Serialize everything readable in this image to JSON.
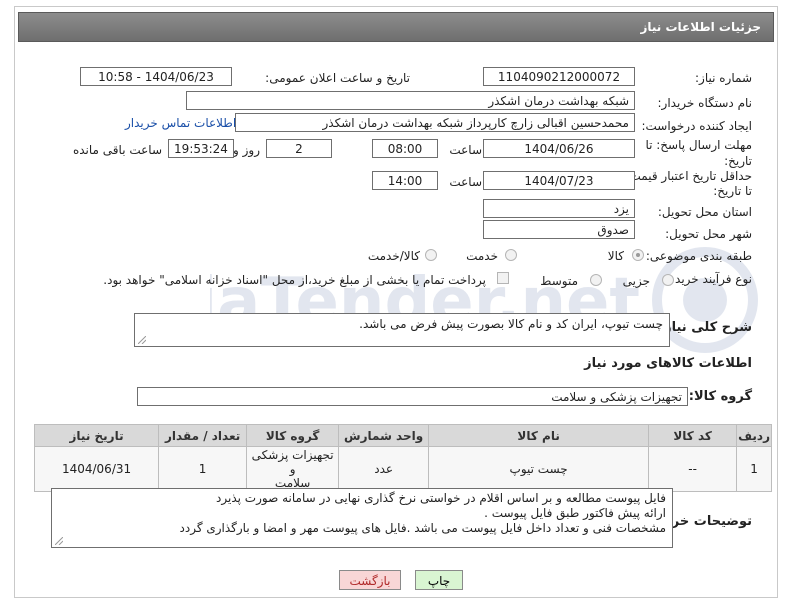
{
  "header": {
    "title": "جزئیات اطلاعات نیاز"
  },
  "form": {
    "need_number": {
      "label": "شماره نیاز:",
      "value": "1104090212000072"
    },
    "announce": {
      "label": "تاریخ و ساعت اعلان عمومی:",
      "value": "1404/06/23 - 10:58"
    },
    "buyer_org": {
      "label": "نام دستگاه خریدار:",
      "value": "شبکه بهداشت درمان اشکذر"
    },
    "creator": {
      "label": "ایجاد کننده درخواست:",
      "value": "محمدحسین اقبالی زارچ کارپرداز شبکه بهداشت درمان اشکذر",
      "contact_link": "اطلاعات تماس خریدار"
    },
    "reply_deadline": {
      "label_line1": "مهلت ارسال پاسخ: تا",
      "label_line2": "تاریخ:",
      "date": "1404/06/26",
      "time_label": "ساعت",
      "time": "08:00",
      "days": "2",
      "days_label": "روز و",
      "remaining": "19:53:24",
      "remaining_label": "ساعت باقی مانده"
    },
    "price_validity": {
      "label_line1": "حداقل تاریخ اعتبار قیمت:",
      "label_line2": "تا تاریخ:",
      "date": "1404/07/23",
      "time_label": "ساعت",
      "time": "14:00"
    },
    "province": {
      "label": "استان محل تحویل:",
      "value": "یزد"
    },
    "city": {
      "label": "شهر محل تحویل:",
      "value": "صدوق"
    },
    "category": {
      "label": "طبقه بندی موضوعی:",
      "options": [
        "کالا",
        "خدمت",
        "کالا/خدمت"
      ],
      "selected": "کالا"
    },
    "purchase_type": {
      "label": "نوع فرآیند خرید :",
      "options": [
        "جزیی",
        "متوسط"
      ],
      "payment_note": "پرداخت تمام یا بخشی از مبلغ خرید،از محل \"اسناد خزانه اسلامی\" خواهد بود."
    },
    "general_description": {
      "label": "شرح کلی نیاز:",
      "value": "چست تیوپ، ایران کد و نام کالا بصورت پیش فرض می باشد."
    }
  },
  "goods_section": {
    "title": "اطلاعات کالاهای مورد نیاز",
    "group_label": "گروه کالا:",
    "group_value": "تجهیزات پزشکی و سلامت",
    "columns": [
      "ردیف",
      "کد کالا",
      "نام کالا",
      "واحد شمارش",
      "گروه کالا",
      "تعداد / مقدار",
      "تاریخ نیاز"
    ],
    "rows": [
      {
        "row": "1",
        "code": "--",
        "name": "چست تیوپ",
        "unit": "عدد",
        "group_l1": "تجهیزات پزشکی و",
        "group_l2": "سلامت",
        "qty": "1",
        "date": "1404/06/31"
      }
    ]
  },
  "buyer_notes": {
    "label": "توضیحات خریدار:",
    "lines": [
      "فایل پیوست مطالعه و بر اساس اقلام در خواستی نرخ گذاری نهایی در سامانه صورت پذیرد",
      "ارائه پیش فاکتور طبق فایل پیوست .",
      "مشخصات فنی و تعداد داخل فایل پیوست می باشد .فایل های پیوست مهر و امضا و بارگذاری گردد"
    ]
  },
  "buttons": {
    "print": "چاپ",
    "back": "بازگشت"
  },
  "watermark": {
    "brand": "AriaTender.net"
  },
  "colors": {
    "header_bg": "#7c7c7c",
    "link": "#1a4fa8",
    "print_btn": "#d9f5d2",
    "back_btn": "#f9d6d6"
  }
}
